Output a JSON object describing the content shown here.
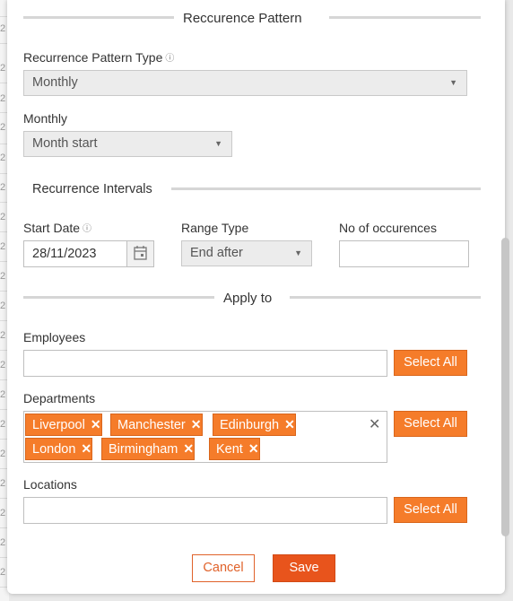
{
  "background": {
    "row_fragments": [
      "2",
      "2",
      "2",
      "2",
      "2",
      "2",
      "2",
      "2",
      "2",
      "2",
      "2",
      "2",
      "2",
      "2",
      "2",
      "2",
      "2",
      "2",
      "2",
      "2",
      "2",
      "2"
    ]
  },
  "pattern_section": {
    "title": "Reccurence Pattern",
    "type_label": "Recurrence Pattern Type",
    "type_value": "Monthly",
    "monthly_label": "Monthly",
    "monthly_value": "Month start"
  },
  "intervals_section": {
    "title": "Recurrence Intervals",
    "start_date_label": "Start Date",
    "start_date_value": "28/11/2023",
    "range_type_label": "Range Type",
    "range_type_value": "End after",
    "occurrences_label": "No of occurences",
    "occurrences_value": ""
  },
  "apply_section": {
    "title": "Apply to",
    "employees_label": "Employees",
    "departments_label": "Departments",
    "departments": [
      "Liverpool",
      "Manchester",
      "Edinburgh",
      "London",
      "Birmingham",
      "Kent"
    ],
    "locations_label": "Locations",
    "select_all_label": "Select All"
  },
  "footer": {
    "cancel_label": "Cancel",
    "save_label": "Save"
  },
  "colors": {
    "accent": "#f57c2a",
    "save": "#e8541c"
  }
}
